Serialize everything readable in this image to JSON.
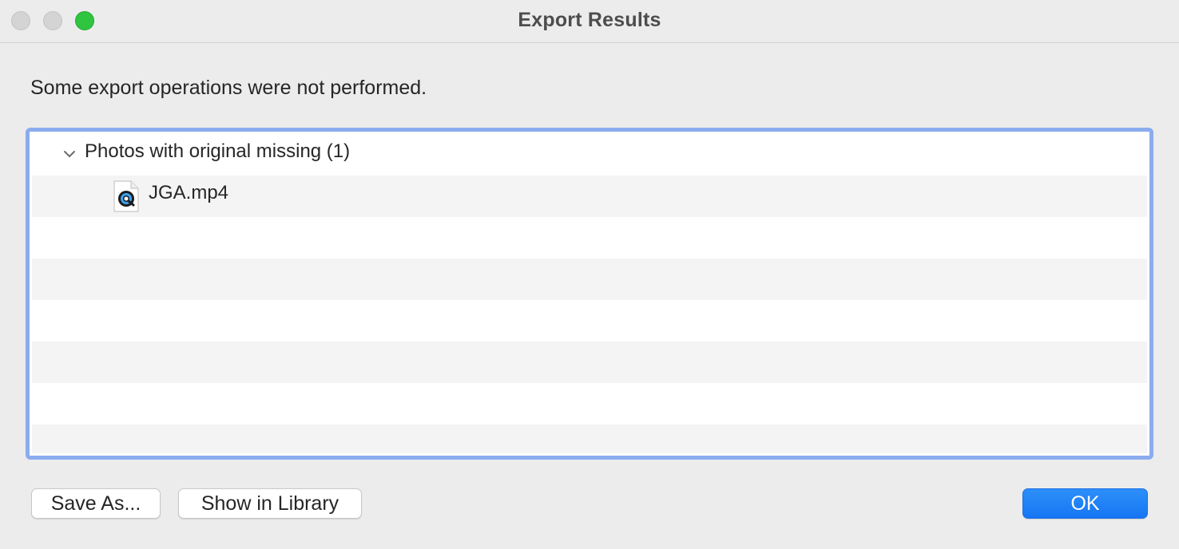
{
  "window": {
    "title": "Export Results"
  },
  "message": "Some export operations were not performed.",
  "results": {
    "group": {
      "label": "Photos with original missing (1)",
      "expanded": true,
      "items": [
        {
          "name": "JGA.mp4",
          "icon": "video-file-icon"
        }
      ]
    }
  },
  "buttons": {
    "save_as": "Save As...",
    "show_in_library": "Show in Library",
    "ok": "OK"
  },
  "colors": {
    "accent": "#1676f3",
    "focus_ring": "#8bacef",
    "zoom_button": "#2fc541"
  }
}
